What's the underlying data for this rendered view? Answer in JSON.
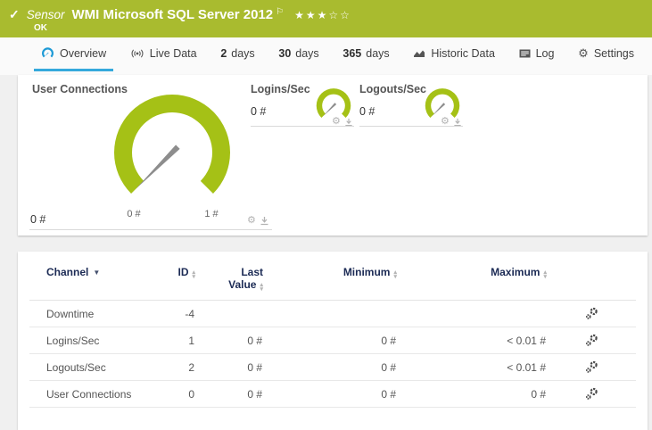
{
  "header": {
    "check_icon": "✓",
    "type_label": "Sensor",
    "title": "WMI Microsoft SQL Server 2012",
    "flag_icon": "⚐",
    "rating_stars": "★★★☆☆",
    "status": "OK",
    "color": "#a9bb2f"
  },
  "tabs": [
    {
      "label": "Overview",
      "active": true
    },
    {
      "label": "Live Data"
    },
    {
      "number": "2",
      "label": "days"
    },
    {
      "number": "30",
      "label": "days"
    },
    {
      "number": "365",
      "label": "days"
    },
    {
      "label": "Historic Data"
    },
    {
      "label": "Log"
    },
    {
      "label": "Settings"
    }
  ],
  "gauges": {
    "color": "#a5c116",
    "needle_color": "#8d8d8d",
    "primary": {
      "title": "User Connections",
      "value": "0 #",
      "scale_min": "0 #",
      "scale_max": "1 #"
    },
    "secondary": [
      {
        "title": "Logins/Sec",
        "value": "0 #"
      },
      {
        "title": "Logouts/Sec",
        "value": "0 #"
      }
    ]
  },
  "icons": {
    "gear": "⚙"
  },
  "table": {
    "headers": {
      "channel": "Channel",
      "id": "ID",
      "last_line1": "Last",
      "last_line2": "Value",
      "minimum": "Minimum",
      "maximum": "Maximum"
    },
    "rows": [
      {
        "channel": "Downtime",
        "id": "-4",
        "last": "",
        "min": "",
        "max": ""
      },
      {
        "channel": "Logins/Sec",
        "id": "1",
        "last": "0 #",
        "min": "0 #",
        "max": "< 0.01 #"
      },
      {
        "channel": "Logouts/Sec",
        "id": "2",
        "last": "0 #",
        "min": "0 #",
        "max": "< 0.01 #"
      },
      {
        "channel": "User Connections",
        "id": "0",
        "last": "0 #",
        "min": "0 #",
        "max": "0 #"
      }
    ]
  }
}
